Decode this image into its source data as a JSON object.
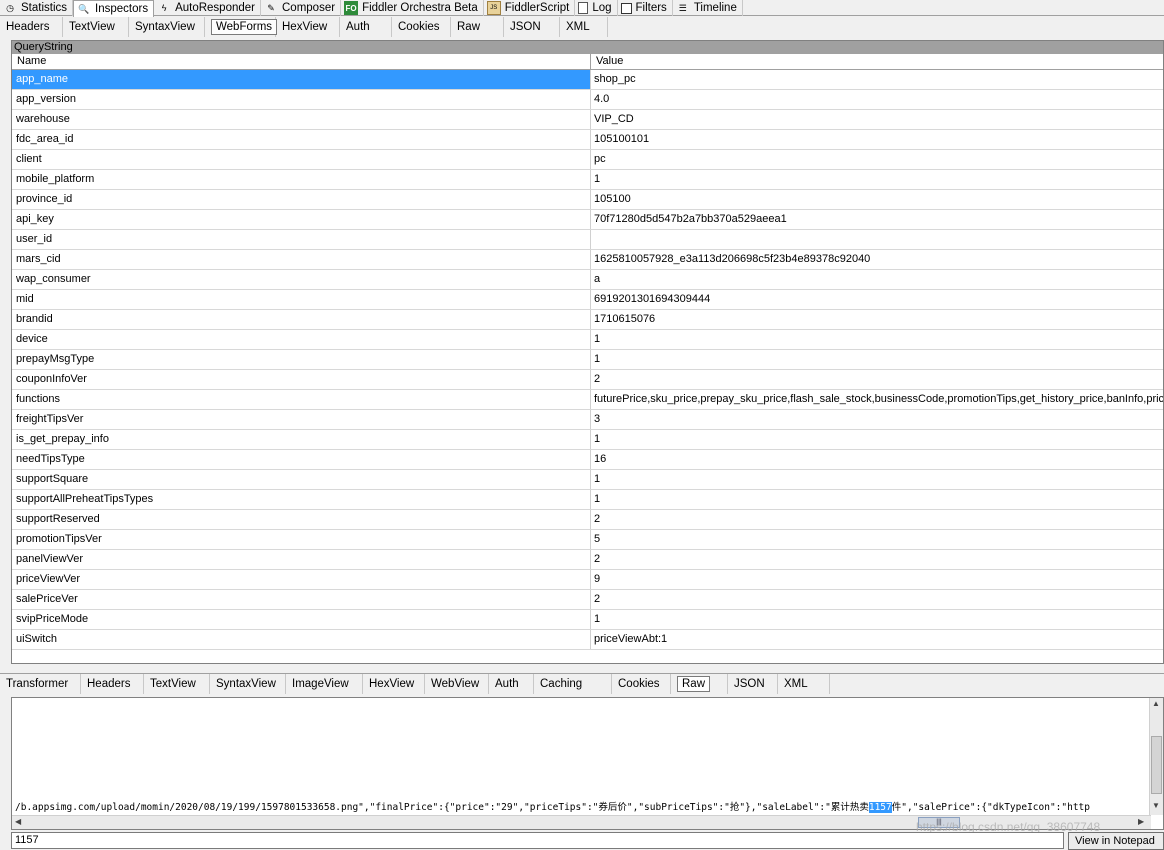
{
  "main_tabs": [
    {
      "label": "Statistics",
      "icon": "stopwatch-icon"
    },
    {
      "label": "Inspectors",
      "icon": "magnifier-icon"
    },
    {
      "label": "AutoResponder",
      "icon": "lightning-icon"
    },
    {
      "label": "Composer",
      "icon": "pencil-icon"
    },
    {
      "label": "Fiddler Orchestra Beta",
      "icon": "fo-icon",
      "icon_text": "FO"
    },
    {
      "label": "FiddlerScript",
      "icon": "js-script-icon",
      "icon_text": "JS"
    },
    {
      "label": "Log",
      "icon": "log-icon"
    },
    {
      "label": "Filters",
      "icon": "checkbox-icon"
    },
    {
      "label": "Timeline",
      "icon": "timeline-icon"
    }
  ],
  "request_tabs": [
    "Headers",
    "TextView",
    "SyntaxView",
    "WebForms",
    "HexView",
    "Auth",
    "Cookies",
    "Raw",
    "JSON",
    "XML"
  ],
  "querystring": {
    "title": "QueryString",
    "col_name": "Name",
    "col_value": "Value",
    "rows": [
      {
        "name": "app_name",
        "value": "shop_pc"
      },
      {
        "name": "app_version",
        "value": "4.0"
      },
      {
        "name": "warehouse",
        "value": "VIP_CD"
      },
      {
        "name": "fdc_area_id",
        "value": "105100101"
      },
      {
        "name": "client",
        "value": "pc"
      },
      {
        "name": "mobile_platform",
        "value": "1"
      },
      {
        "name": "province_id",
        "value": "105100"
      },
      {
        "name": "api_key",
        "value": "70f71280d5d547b2a7bb370a529aeea1"
      },
      {
        "name": "user_id",
        "value": ""
      },
      {
        "name": "mars_cid",
        "value": "1625810057928_e3a113d206698c5f23b4e89378c92040"
      },
      {
        "name": "wap_consumer",
        "value": "a"
      },
      {
        "name": "mid",
        "value": "6919201301694309444"
      },
      {
        "name": "brandid",
        "value": "1710615076"
      },
      {
        "name": "device",
        "value": "1"
      },
      {
        "name": "prepayMsgType",
        "value": "1"
      },
      {
        "name": "couponInfoVer",
        "value": "2"
      },
      {
        "name": "functions",
        "value": "futurePrice,sku_price,prepay_sku_price,flash_sale_stock,businessCode,promotionTips,get_history_price,banInfo,price"
      },
      {
        "name": "freightTipsVer",
        "value": "3"
      },
      {
        "name": "is_get_prepay_info",
        "value": "1"
      },
      {
        "name": "needTipsType",
        "value": "16"
      },
      {
        "name": "supportSquare",
        "value": "1"
      },
      {
        "name": "supportAllPreheatTipsTypes",
        "value": "1"
      },
      {
        "name": "supportReserved",
        "value": "2"
      },
      {
        "name": "promotionTipsVer",
        "value": "5"
      },
      {
        "name": "panelViewVer",
        "value": "2"
      },
      {
        "name": "priceViewVer",
        "value": "9"
      },
      {
        "name": "salePriceVer",
        "value": "2"
      },
      {
        "name": "svipPriceMode",
        "value": "1"
      },
      {
        "name": "uiSwitch",
        "value": "priceViewAbt:1"
      }
    ]
  },
  "response_tabs": [
    "Transformer",
    "Headers",
    "TextView",
    "SyntaxView",
    "ImageView",
    "HexView",
    "WebView",
    "Auth",
    "Caching",
    "Cookies",
    "Raw",
    "JSON",
    "XML"
  ],
  "response": {
    "line_before": "/b.appsimg.com/upload/momin/2020/08/19/199/1597801533658.png\",\"finalPrice\":{\"price\":\"29\",\"priceTips\":\"券后价\",\"subPriceTips\":\"抢\"},\"saleLabel\":\"累计热卖",
    "line_highlight": "1157",
    "line_after": "件\",\"salePrice\":{\"dkTypeIcon\":\"http"
  },
  "find_value": "1157",
  "view_in_notepad": "View in Notepad",
  "watermark": "https://blog.csdn.net/qq_38607748"
}
